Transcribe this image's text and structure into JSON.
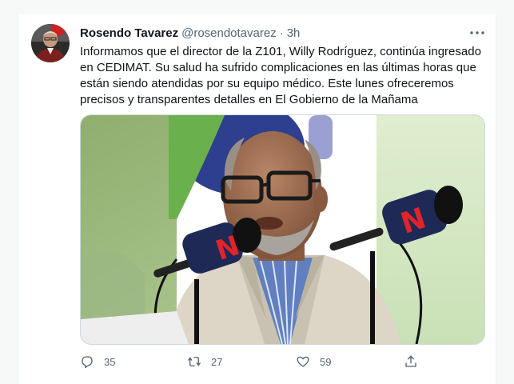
{
  "tweet": {
    "author": {
      "display_name": "Rosendo Tavarez",
      "handle": "@rosendotavarez",
      "separator": "·",
      "time": "3h"
    },
    "text": "Informamos que el director de la Z101, Willy Rodríguez, continúa ingresado en CEDIMAT. Su salud ha sufrido complicaciones en las últimas horas que están siendo atendidas por su equipo médico. Este lunes ofreceremos precisos y transparentes detalles en El Gobierno de la Mañama",
    "media": {
      "mic_logo_letter_left": "N",
      "mic_logo_letter_right": "N"
    },
    "actions": {
      "reply_count": "35",
      "retweet_count": "27",
      "like_count": "59"
    }
  },
  "icons": {
    "more": "more-dots-icon",
    "reply": "reply-icon",
    "retweet": "retweet-icon",
    "like": "heart-icon",
    "share": "share-icon"
  },
  "colors": {
    "text_primary": "#0f1419",
    "text_secondary": "#536471",
    "border": "#cfd9de",
    "mic_logo_red": "#e0242a",
    "mic_logo_navy": "#1e2a55"
  }
}
